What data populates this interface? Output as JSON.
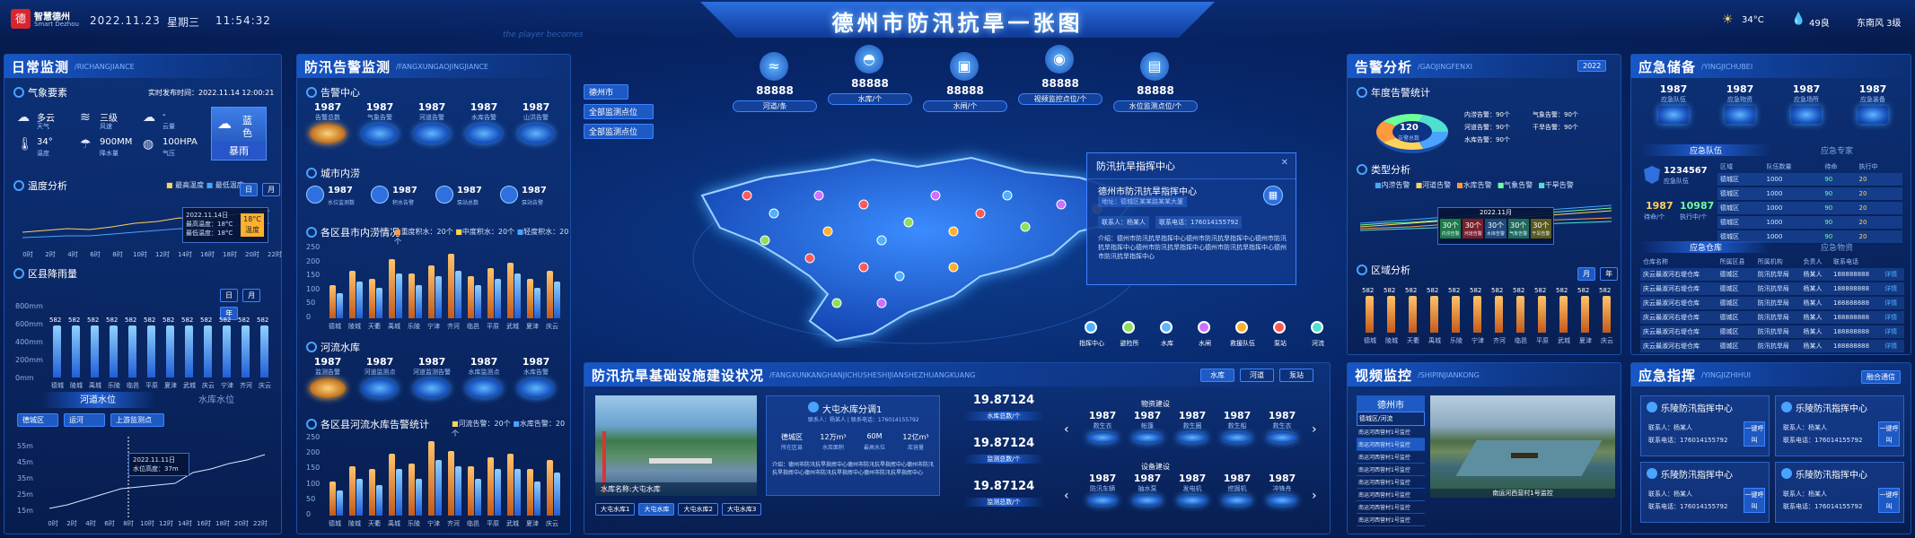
{
  "header": {
    "logo_line1": "智慧德州",
    "logo_line2": "Smart Dezhou",
    "date": "2022.11.23",
    "weekday": "星期三",
    "time": "11:54:32",
    "title": "德州市防汛抗旱一张图",
    "weather_temp": "34°C",
    "humidity": "49良",
    "wind": "东南风 3级",
    "slogan": "the player becomes"
  },
  "daily": {
    "title": "日常监测",
    "en": "/RICHANGJIANCE",
    "weather_sub": "气象要素",
    "publish_label": "实时发布时间：",
    "publish_time": "2022.11.14 12:00:21",
    "weather": [
      {
        "v": "多云",
        "l": "天气",
        "icon": "cloud-icon"
      },
      {
        "v": "三级",
        "l": "风速",
        "icon": "wind-icon"
      },
      {
        "v": "-",
        "l": "云量",
        "icon": "cloud-cover-icon"
      },
      {
        "v": "34°",
        "l": "温度",
        "icon": "thermometer-icon"
      },
      {
        "v": "900MM",
        "l": "降水量",
        "icon": "rain-gauge-icon"
      },
      {
        "v": "100HPA",
        "l": "气压",
        "icon": "pressure-icon"
      }
    ],
    "alert_level": "蓝色",
    "alert_type": "暴雨",
    "temp_sub": "温度分析",
    "temp_legend": [
      "最高温度",
      "最低温度"
    ],
    "temp_tabs": [
      "日",
      "月"
    ],
    "tooltip_date": "2022.11.14日",
    "tooltip_hi": "最高温度：18°C",
    "tooltip_lo": "最低温度：18°C",
    "tooltip_badge": "18°C",
    "tooltip_badge_sub": "温度",
    "temp_x": [
      "0时",
      "2时",
      "4时",
      "6时",
      "8时",
      "10时",
      "12时",
      "14时",
      "16时",
      "18时",
      "20时",
      "22时"
    ],
    "rain_sub": "区县降雨量",
    "rain_tabs": [
      "日",
      "月",
      "年"
    ],
    "rain_ylabels": [
      "800mm",
      "600mm",
      "400mm",
      "200mm",
      "0mm"
    ],
    "rain_counties": [
      "德城",
      "陵城",
      "禹城",
      "乐陵",
      "临邑",
      "平原",
      "夏津",
      "武城",
      "庆云",
      "宁津",
      "齐河",
      "庆云"
    ],
    "rain_values": [
      582,
      582,
      582,
      582,
      582,
      582,
      582,
      582,
      582,
      582,
      582,
      582
    ],
    "water_tabs": [
      "河道水位",
      "水库水位"
    ],
    "water_selects": [
      "德城区",
      "运河",
      "上游监测点"
    ],
    "water_ylabels": [
      "55m",
      "45m",
      "35m",
      "25m",
      "15m"
    ],
    "water_x": [
      "0时",
      "2时",
      "4时",
      "6时",
      "8时",
      "10时",
      "12时",
      "14时",
      "16时",
      "18时",
      "20时",
      "22时"
    ],
    "water_tooltip_date": "2022.11.11日",
    "water_tooltip": "水位高度：37m"
  },
  "warn": {
    "title": "防汛告警监测",
    "en": "/FANGXUNGAOJINGJIANCE",
    "center_sub": "告警中心",
    "center": [
      {
        "v": "1987",
        "l": "告警总数"
      },
      {
        "v": "1987",
        "l": "气象告警"
      },
      {
        "v": "1987",
        "l": "河道告警"
      },
      {
        "v": "1987",
        "l": "水库告警"
      },
      {
        "v": "1987",
        "l": "山洪告警"
      }
    ],
    "flood_sub": "城市内涝",
    "flood": [
      {
        "v": "1987",
        "l": "水位监测数"
      },
      {
        "v": "1987",
        "l": "积水告警"
      },
      {
        "v": "1987",
        "l": "泵站总数"
      },
      {
        "v": "1987",
        "l": "泵站告警"
      }
    ],
    "flood_chart_sub": "各区县市内涝情况",
    "flood_legend": [
      "重度积水：20个",
      "中度积水：20个",
      "轻度积水：20个"
    ],
    "flood_ylabels": [
      "250",
      "200",
      "150",
      "100",
      "50",
      "0"
    ],
    "counties": [
      "德城",
      "陵城",
      "天衢",
      "禹城",
      "乐陵",
      "宁津",
      "齐河",
      "临邑",
      "平原",
      "武城",
      "夏津",
      "庆云"
    ],
    "flood_a": [
      120,
      170,
      140,
      210,
      160,
      190,
      230,
      150,
      180,
      200,
      140,
      170
    ],
    "flood_b": [
      90,
      130,
      110,
      160,
      120,
      150,
      170,
      120,
      140,
      160,
      110,
      130
    ],
    "river_sub": "河流水库",
    "river": [
      {
        "v": "1987",
        "l": "监测告警"
      },
      {
        "v": "1987",
        "l": "河道监测点"
      },
      {
        "v": "1987",
        "l": "河道监测告警"
      },
      {
        "v": "1987",
        "l": "水库监测点"
      },
      {
        "v": "1987",
        "l": "水库告警"
      }
    ],
    "river_chart_sub": "各区县河流水库告警统计",
    "river_legend": [
      "河流告警：20个",
      "水库告警：20个"
    ],
    "river_ylabels": [
      "250",
      "200",
      "150",
      "100",
      "50",
      "0"
    ],
    "river_a": [
      110,
      160,
      150,
      200,
      170,
      240,
      210,
      160,
      190,
      200,
      150,
      180
    ],
    "river_b": [
      80,
      120,
      100,
      150,
      120,
      180,
      160,
      120,
      150,
      150,
      110,
      140
    ]
  },
  "map": {
    "selects": [
      "德州市",
      "全部监测点位",
      "全部监测点位"
    ],
    "tops": [
      {
        "v": "88888",
        "l": "河道/条",
        "icon": "river-icon"
      },
      {
        "v": "88888",
        "l": "水库/个",
        "icon": "reservoir-icon"
      },
      {
        "v": "88888",
        "l": "水闸/个",
        "icon": "sluice-icon"
      },
      {
        "v": "88888",
        "l": "视频监控点位/个",
        "icon": "camera-icon"
      },
      {
        "v": "88888",
        "l": "水位监测点位/个",
        "icon": "gauge-icon"
      }
    ],
    "popup_title": "防汛抗旱指挥中心",
    "popup_name": "德州市防汛抗旱指挥中心",
    "popup_addr": "地址：德城区某某路某某大厦",
    "popup_contact": "联系人：杨某人",
    "popup_phone": "联系电话：176014155792",
    "popup_desc": "介绍：德州市防汛抗旱指挥中心德州市防汛抗旱指挥中心德州市防汛抗旱指挥中心德州市防汛抗旱指挥中心德州市防汛抗旱指挥中心德州市防汛抗旱指挥中心",
    "legend": [
      "指挥中心",
      "避险所",
      "水库",
      "水闸",
      "救援队伍",
      "泵站",
      "河流"
    ]
  },
  "infra": {
    "title": "防汛抗旱基础设施建设状况",
    "en": "/FANGXUNKANGHANJICHUSHESHIJIANSHEZHUANGKUANG",
    "tabs": [
      "水库",
      "河道",
      "泵站"
    ],
    "photo_caption": "水库名称:大屯水库",
    "card_title": "大屯水库分调1",
    "card_contact": "联系人：杨某人 | 联系电话：176014155792",
    "card_stats": [
      {
        "v": "德城区",
        "l": "所在区县"
      },
      {
        "v": "12万m³",
        "l": "水库面积"
      },
      {
        "v": "60M",
        "l": "最高水位"
      },
      {
        "v": "12亿m³",
        "l": "库容量"
      }
    ],
    "card_desc": "介绍：德州市防汛抗旱指挥中心德州市防汛抗旱指挥中心德州市防汛抗旱指挥中心德州市防汛抗旱指挥中心德州市防汛抗旱指挥中心",
    "reservoirs": [
      "大屯水库1",
      "大屯水库",
      "大屯水库2",
      "大屯水库3"
    ],
    "totals": [
      {
        "v": "19.87124",
        "l": "水库总数/个"
      },
      {
        "v": "19.87124",
        "l": "监测总数/个"
      },
      {
        "v": "19.87124",
        "l": "监测总数/个"
      }
    ],
    "material_sub": "物资建设",
    "material": [
      {
        "v": "1987",
        "l": "救生衣"
      },
      {
        "v": "1987",
        "l": "帐篷"
      },
      {
        "v": "1987",
        "l": "救生圈"
      },
      {
        "v": "1987",
        "l": "救生船"
      },
      {
        "v": "1987",
        "l": "救生衣"
      }
    ],
    "equip_sub": "设备建设",
    "equip": [
      {
        "v": "1987",
        "l": "防汛车辆"
      },
      {
        "v": "1987",
        "l": "抽水泵"
      },
      {
        "v": "1987",
        "l": "发电机"
      },
      {
        "v": "1987",
        "l": "挖掘机"
      },
      {
        "v": "1987",
        "l": "冲锋舟"
      }
    ]
  },
  "analysis": {
    "title": "告警分析",
    "en": "/GAOJINGFENXI",
    "year": "2022",
    "year_sub": "年度告警统计",
    "donut_v": "120",
    "donut_l": "告警总数",
    "donut_legend": [
      "内涝告警：90个",
      "气象告警：90个",
      "河道告警：90个",
      "干旱告警：90个",
      "水库告警：90个"
    ],
    "type_sub": "类型分析",
    "type_legend": [
      "内涝告警",
      "河道告警",
      "水库告警",
      "气象告警",
      "干旱告警"
    ],
    "type_tooltip_date": "2022.11月",
    "type_tooltip": [
      {
        "v": "30个",
        "l": "内涝告警"
      },
      {
        "v": "30个",
        "l": "河道告警"
      },
      {
        "v": "30个",
        "l": "水库告警"
      },
      {
        "v": "30个",
        "l": "气象告警"
      },
      {
        "v": "30个",
        "l": "干旱告警"
      }
    ],
    "region_sub": "区域分析",
    "region_tabs": [
      "月",
      "年"
    ],
    "region_values": [
      582,
      582,
      582,
      582,
      582,
      582,
      582,
      582,
      582,
      582,
      582,
      582
    ],
    "region_x": [
      "德城",
      "陵城",
      "天衢",
      "禹城",
      "乐陵",
      "宁津",
      "齐河",
      "临邑",
      "平原",
      "武城",
      "夏津",
      "庆云"
    ]
  },
  "reserve": {
    "title": "应急储备",
    "en": "/YINGJICHUBEI",
    "tops": [
      {
        "v": "1987",
        "l": "应急队伍"
      },
      {
        "v": "1987",
        "l": "应急物资"
      },
      {
        "v": "1987",
        "l": "应急场所"
      },
      {
        "v": "1987",
        "l": "应急装备"
      }
    ],
    "tabs": [
      "应急队伍",
      "应急专家"
    ],
    "team_v": "1234567",
    "team_l": "应急队伍",
    "team_wait": "1987",
    "team_wait_l": "待命/个",
    "team_exec": "10987",
    "team_exec_l": "执行中/个",
    "team_head": [
      "区域",
      "队伍数量",
      "待命",
      "执行中"
    ],
    "team_rows": [
      [
        "德城区",
        "1000",
        "90",
        "20"
      ],
      [
        "德城区",
        "1000",
        "90",
        "20"
      ],
      [
        "德城区",
        "1000",
        "90",
        "20"
      ],
      [
        "德城区",
        "1000",
        "90",
        "20"
      ],
      [
        "德城区",
        "1000",
        "90",
        "20"
      ]
    ],
    "store_tabs": [
      "应急仓库",
      "应急物资"
    ],
    "store_head": [
      "仓库名称",
      "所属区县",
      "所属机构",
      "负责人",
      "联系电话",
      ""
    ],
    "store_rows": [
      [
        "庆云最淑河右堤仓库",
        "德城区",
        "防汛抗旱局",
        "杨某人",
        "188888888",
        "详情"
      ],
      [
        "庆云最淑河右堤仓库",
        "德城区",
        "防汛抗旱局",
        "杨某人",
        "188888888",
        "详情"
      ],
      [
        "庆云最淑河右堤仓库",
        "德城区",
        "防汛抗旱局",
        "杨某人",
        "188888888",
        "详情"
      ],
      [
        "庆云最淑河右堤仓库",
        "德城区",
        "防汛抗旱局",
        "杨某人",
        "188888888",
        "详情"
      ],
      [
        "庆云最淑河右堤仓库",
        "德城区",
        "防汛抗旱局",
        "杨某人",
        "188888888",
        "详情"
      ],
      [
        "庆云最淑河右堤仓库",
        "德城区",
        "防汛抗旱局",
        "杨某人",
        "188888888",
        "详情"
      ]
    ]
  },
  "video": {
    "title": "视频监控",
    "en": "/SHIPINJIANKONG",
    "city": "德州市",
    "select": "德城区/河流",
    "list": [
      "南运河西营村1号监控",
      "南运河西营村1号监控",
      "南运河西营村1号监控",
      "南运河西营村1号监控",
      "南运河西营村1号监控",
      "南运河西营村1号监控",
      "南运河西营村1号监控",
      "南运河西营村1号监控"
    ],
    "caption": "南运河西营村1号监控"
  },
  "command": {
    "title": "应急指挥",
    "en": "/YINGJIZHIHUI",
    "btn": "融合通信",
    "items": [
      {
        "name": "乐陵防汛指挥中心",
        "contact": "联系人：杨某人",
        "phone": "联系电话：176014155792",
        "btn": "一键呼叫"
      },
      {
        "name": "乐陵防汛指挥中心",
        "contact": "联系人：杨某人",
        "phone": "联系电话：176014155792",
        "btn": "一键呼叫"
      },
      {
        "name": "乐陵防汛指挥中心",
        "contact": "联系人：杨某人",
        "phone": "联系电话：176014155792",
        "btn": "一键呼叫"
      },
      {
        "name": "乐陵防汛指挥中心",
        "contact": "联系人：杨某人",
        "phone": "联系电话：176014155792",
        "btn": "一键呼叫"
      }
    ]
  }
}
